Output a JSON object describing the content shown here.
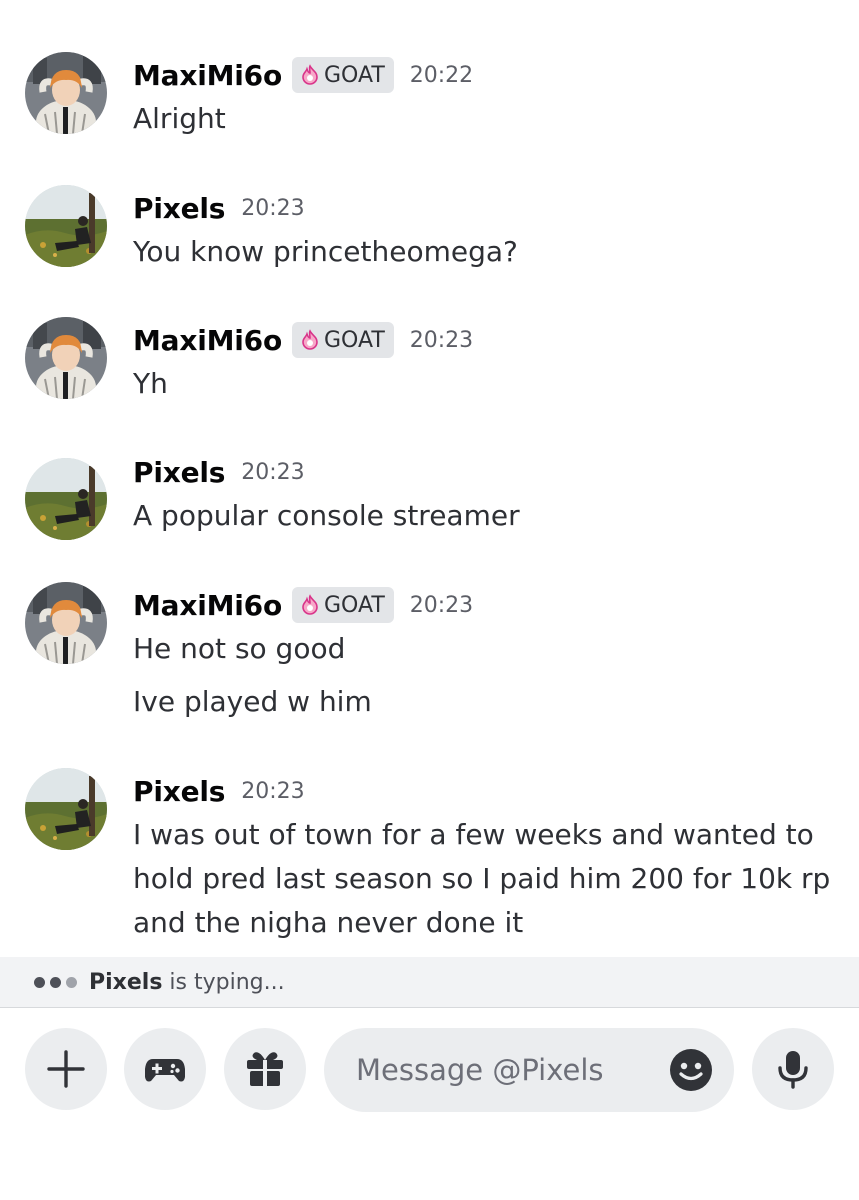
{
  "colors": {
    "background": "#ffffff",
    "text": "#2e3035",
    "muted": "#5c5e66",
    "tag_bg": "#e3e5e8",
    "composer_bg": "#ebedef",
    "typing_bar_bg": "#f2f3f5"
  },
  "messages": [
    {
      "author": "MaxiMi6o",
      "tag": "GOAT",
      "tag_icon": "pink-flame-icon",
      "time": "20:22",
      "lines": [
        "Alright"
      ]
    },
    {
      "author": "Pixels",
      "time": "20:23",
      "lines": [
        "You know princetheomega?"
      ]
    },
    {
      "author": "MaxiMi6o",
      "tag": "GOAT",
      "tag_icon": "pink-flame-icon",
      "time": "20:23",
      "lines": [
        "Yh"
      ]
    },
    {
      "author": "Pixels",
      "time": "20:23",
      "lines": [
        "A popular console streamer"
      ]
    },
    {
      "author": "MaxiMi6o",
      "tag": "GOAT",
      "tag_icon": "pink-flame-icon",
      "time": "20:23",
      "lines": [
        "He not so good",
        "Ive played w him"
      ]
    },
    {
      "author": "Pixels",
      "time": "20:23",
      "lines": [
        "I was out of town for a few weeks and wanted to",
        "hold pred last season so I paid him 200 for 10k rp",
        "and the nigha never done it"
      ]
    }
  ],
  "typing": {
    "user": "Pixels",
    "suffix": " is typing..."
  },
  "composer": {
    "placeholder": "Message @Pixels",
    "buttons": [
      "plus-icon",
      "gamepad-icon",
      "gift-icon",
      "emoji-icon",
      "microphone-icon"
    ]
  }
}
